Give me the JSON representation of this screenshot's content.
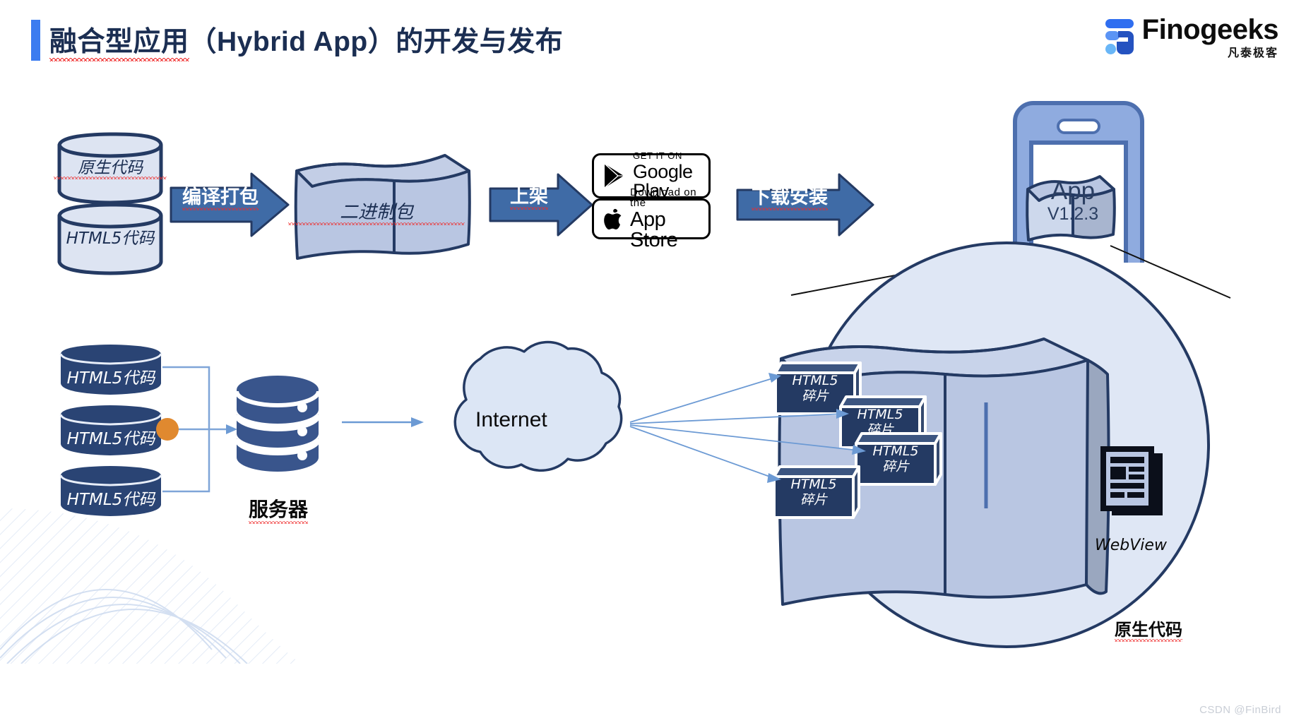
{
  "header": {
    "title_cn_1": "融合型应用",
    "title_rest": "（Hybrid App）的开发与发布",
    "accent_color": "#3c7cf0"
  },
  "logo": {
    "name": "Finogeeks",
    "subtitle": "凡泰极客",
    "mark_icon": "finogeeks-logo-icon"
  },
  "top_flow": {
    "sources": [
      {
        "label": "原生代码"
      },
      {
        "label": "HTML5代码"
      }
    ],
    "arrow_build": "编译打包",
    "binary_box": "二进制包",
    "arrow_publish": "上架",
    "stores": [
      {
        "small": "GET IT ON",
        "large": "Google Play",
        "icon": "google-play-icon"
      },
      {
        "small": "Download on the",
        "large": "App Store",
        "icon": "apple-icon"
      }
    ],
    "arrow_download": "下载安装",
    "device": {
      "icon": "phone-icon",
      "app_name": "App",
      "app_version": "V1.2.3"
    }
  },
  "bottom_flow": {
    "html_stores": [
      {
        "label": "HTML5代码"
      },
      {
        "label": "HTML5代码"
      },
      {
        "label": "HTML5代码"
      }
    ],
    "node_dot_color": "#e0892f",
    "server": {
      "label": "服务器",
      "icon": "database-icon"
    },
    "cloud": {
      "label": "Internet",
      "icon": "cloud-icon"
    }
  },
  "magnifier": {
    "fragments": [
      {
        "line1": "HTML5",
        "line2": "碎片"
      },
      {
        "line1": "HTML5",
        "line2": "碎片"
      },
      {
        "line1": "HTML5",
        "line2": "碎片"
      },
      {
        "line1": "HTML5",
        "line2": "碎片"
      }
    ],
    "webview_label": "WebView",
    "webview_icon": "webview-document-icon",
    "native_label": "原生代码"
  },
  "watermark": "CSDN @FinBird",
  "colors": {
    "navy_stroke": "#243a63",
    "light_fill": "#dde4f2",
    "box_fill": "#b9c6e2",
    "dark_navy": "#2a4474",
    "arrow_blue": "#3f6ba6",
    "circle_fill": "#dfe7f5",
    "phone_blue": "#7e9ddb"
  }
}
